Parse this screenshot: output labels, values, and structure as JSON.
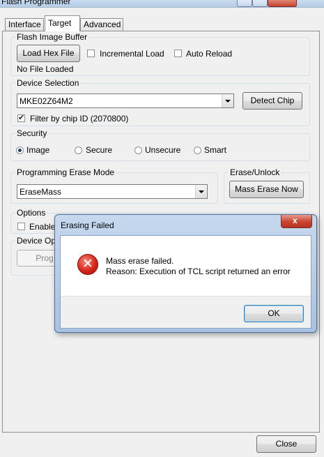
{
  "window": {
    "title": "Flash Programmer"
  },
  "tabs": [
    {
      "label": "Interface"
    },
    {
      "label": "Target"
    },
    {
      "label": "Advanced"
    }
  ],
  "flash_image_buffer": {
    "legend": "Flash Image Buffer",
    "load_hex_button": "Load Hex File",
    "incremental_load_label": "Incremental Load",
    "auto_reload_label": "Auto Reload",
    "status": "No File Loaded"
  },
  "device_selection": {
    "legend": "Device Selection",
    "device_value": "MKE02Z64M2",
    "detect_chip_button": "Detect Chip",
    "filter_label": "Filter by chip ID (2070800)"
  },
  "security": {
    "legend": "Security",
    "options": [
      {
        "label": "Image",
        "selected": true
      },
      {
        "label": "Secure",
        "selected": false
      },
      {
        "label": "Unsecure",
        "selected": false
      },
      {
        "label": "Smart",
        "selected": false
      }
    ]
  },
  "programming_erase_mode": {
    "legend": "Programming Erase Mode",
    "value": "EraseMass"
  },
  "erase_unlock": {
    "legend": "Erase/Unlock",
    "mass_erase_button": "Mass Erase Now"
  },
  "options": {
    "legend": "Options",
    "enable_label_partial": "Enable"
  },
  "device_operations": {
    "legend_partial": "Device Op",
    "program_button_partial": "Prog"
  },
  "footer": {
    "close_button": "Close"
  },
  "dialog": {
    "title": "Erasing Failed",
    "close_glyph": "x",
    "message_line1": "Mass erase failed.",
    "message_line2": "Reason: Execution of TCL script returned an error",
    "ok_button": "OK",
    "icon": "error-icon"
  }
}
